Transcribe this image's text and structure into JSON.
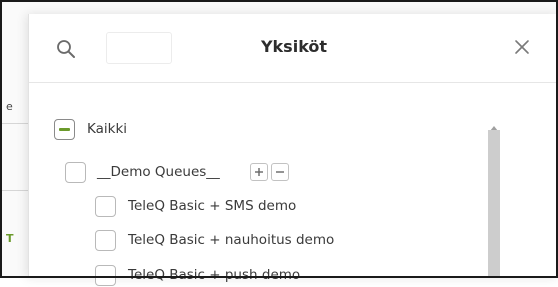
{
  "background": {
    "fragment_1": "e",
    "fragment_2": "T"
  },
  "modal": {
    "title": "Yksiköt",
    "search": {
      "value": "",
      "placeholder": "",
      "icon": "search-icon"
    },
    "close_icon": "close-icon"
  },
  "list": {
    "all": {
      "label": "Kaikki",
      "state": "partial"
    },
    "group": {
      "label": "__Demo Queues__",
      "expand_label": "+",
      "collapse_label": "−",
      "checked": false
    },
    "children": [
      {
        "label": "TeleQ Basic + SMS demo",
        "checked": false
      },
      {
        "label": "TeleQ Basic + nauhoitus demo",
        "checked": false
      },
      {
        "label": "TeleQ Basic + push demo",
        "checked": false
      }
    ]
  },
  "colors": {
    "accent": "#6b9a2b",
    "scroll_thumb": "#cdcdcd",
    "border": "#b9b9b9"
  }
}
